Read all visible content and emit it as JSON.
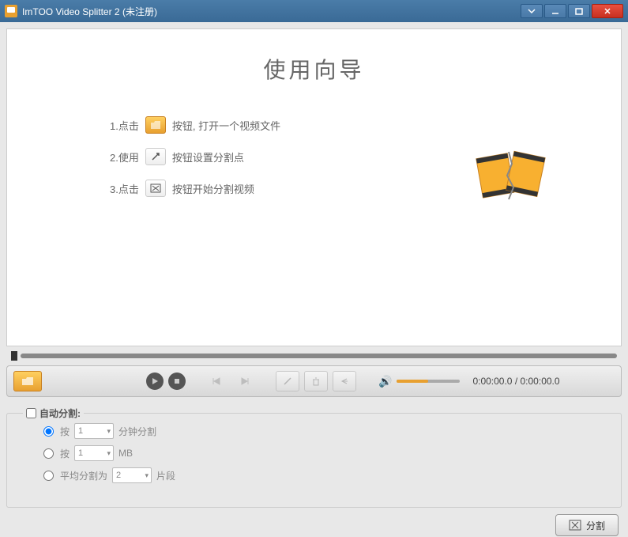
{
  "title": "ImTOO Video Splitter 2 (未注册)",
  "wizard": {
    "title": "使用向导",
    "steps": [
      {
        "prefix": "1.点击",
        "suffix": "按钮, 打开一个视频文件"
      },
      {
        "prefix": "2.使用",
        "suffix": "按钮设置分割点"
      },
      {
        "prefix": "3.点击",
        "suffix": "按钮开始分割视频"
      }
    ]
  },
  "time": {
    "current": "0:00:00.0",
    "sep": " / ",
    "total": "0:00:00.0"
  },
  "autosplit": {
    "legend": "自动分割:",
    "opt1_label": "按",
    "opt1_val": "1",
    "opt1_unit": "分钟分割",
    "opt2_label": "按",
    "opt2_val": "1",
    "opt2_unit": "MB",
    "opt3_label": "平均分割为",
    "opt3_val": "2",
    "opt3_unit": "片段"
  },
  "split_button": "分割"
}
